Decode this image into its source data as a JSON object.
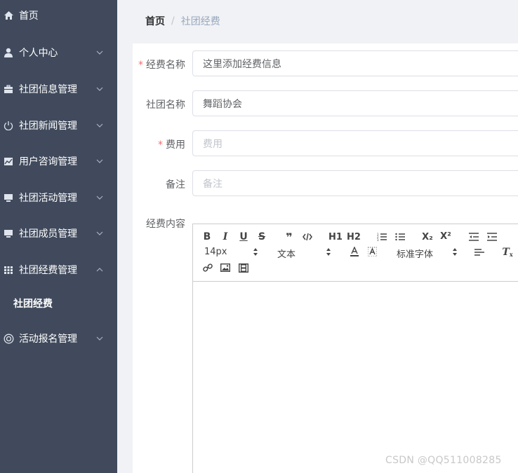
{
  "sidebar": {
    "items": [
      {
        "label": "首页",
        "icon": "home-icon"
      },
      {
        "label": "个人中心",
        "icon": "user-icon"
      },
      {
        "label": "社团信息管理",
        "icon": "briefcase-icon"
      },
      {
        "label": "社团新闻管理",
        "icon": "power-icon"
      },
      {
        "label": "用户咨询管理",
        "icon": "chart-icon"
      },
      {
        "label": "社团活动管理",
        "icon": "monitor-icon"
      },
      {
        "label": "社团成员管理",
        "icon": "monitor-icon"
      },
      {
        "label": "社团经费管理",
        "icon": "grid-icon"
      },
      {
        "label": "社团经费",
        "icon": ""
      },
      {
        "label": "活动报名管理",
        "icon": "lifebuoy-icon"
      }
    ]
  },
  "breadcrumb": {
    "home": "首页",
    "separator": "/",
    "current": "社团经费"
  },
  "form": {
    "fee_name": {
      "label": "经费名称",
      "required": "*",
      "value": "这里添加经费信息"
    },
    "club_name": {
      "label": "社团名称",
      "value": "舞蹈协会"
    },
    "cost": {
      "label": "费用",
      "required": "*",
      "placeholder": "费用"
    },
    "remark": {
      "label": "备注",
      "placeholder": "备注"
    },
    "content": {
      "label": "经费内容"
    }
  },
  "editor": {
    "font_size": "14px",
    "header_select": "文本",
    "font_family": "标准字体",
    "buttons": [
      "bold",
      "italic",
      "underline",
      "strike",
      "blockquote",
      "code-block",
      "header-1",
      "header-2",
      "ordered-list",
      "bullet-list",
      "subscript",
      "superscript",
      "indent-decrease",
      "indent-increase",
      "font-color",
      "background-color",
      "align",
      "clean",
      "link",
      "image",
      "video"
    ],
    "h1": "H1",
    "h2": "H2",
    "x_sub": "X₂",
    "x_sup": "X²"
  },
  "watermark": "CSDN @QQ511008285",
  "colors": {
    "sidebar_bg": "#404a5c",
    "required": "#f56c6c",
    "breadcrumb_current": "#97a8be"
  }
}
